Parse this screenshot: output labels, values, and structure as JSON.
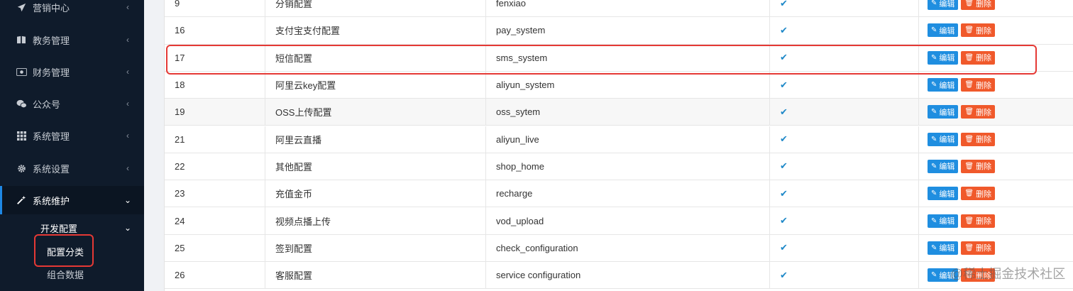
{
  "sidebar": {
    "items": [
      {
        "label": "营销中心",
        "icon": "paper-plane-icon",
        "chevron": "‹"
      },
      {
        "label": "教务管理",
        "icon": "book-icon",
        "chevron": "‹"
      },
      {
        "label": "财务管理",
        "icon": "money-icon",
        "chevron": "‹"
      },
      {
        "label": "公众号",
        "icon": "wechat-icon",
        "chevron": "‹"
      },
      {
        "label": "系统管理",
        "icon": "grid-icon",
        "chevron": "‹"
      },
      {
        "label": "系统设置",
        "icon": "gear-icon",
        "chevron": "‹"
      },
      {
        "label": "系统维护",
        "icon": "magic-wand-icon",
        "chevron": "⌄"
      }
    ],
    "submenu": {
      "label": "开发配置",
      "chevron": "⌄",
      "children": [
        {
          "label": "配置分类"
        },
        {
          "label": "组合数据"
        }
      ]
    },
    "accent_color": "#1e88e5"
  },
  "table": {
    "rows": [
      {
        "id": "9",
        "name": "分销配置",
        "key": "fenxiao",
        "enabled": "✔"
      },
      {
        "id": "16",
        "name": "支付宝支付配置",
        "key": "pay_system",
        "enabled": "✔"
      },
      {
        "id": "17",
        "name": "短信配置",
        "key": "sms_system",
        "enabled": "✔"
      },
      {
        "id": "18",
        "name": "阿里云key配置",
        "key": "aliyun_system",
        "enabled": "✔"
      },
      {
        "id": "19",
        "name": "OSS上传配置",
        "key": "oss_sytem",
        "enabled": "✔"
      },
      {
        "id": "21",
        "name": "阿里云直播",
        "key": "aliyun_live",
        "enabled": "✔"
      },
      {
        "id": "22",
        "name": "其他配置",
        "key": "shop_home",
        "enabled": "✔"
      },
      {
        "id": "23",
        "name": "充值金币",
        "key": "recharge",
        "enabled": "✔"
      },
      {
        "id": "24",
        "name": "视频点播上传",
        "key": "vod_upload",
        "enabled": "✔"
      },
      {
        "id": "25",
        "name": "签到配置",
        "key": "check_configuration",
        "enabled": "✔"
      },
      {
        "id": "26",
        "name": "客服配置",
        "key": "service configuration",
        "enabled": "✔"
      }
    ],
    "edit_label": "编辑",
    "delete_label": "删除",
    "edit_color": "#1f8ee0",
    "delete_color": "#f0592b"
  },
  "watermark": "@稀土掘金技术社区"
}
